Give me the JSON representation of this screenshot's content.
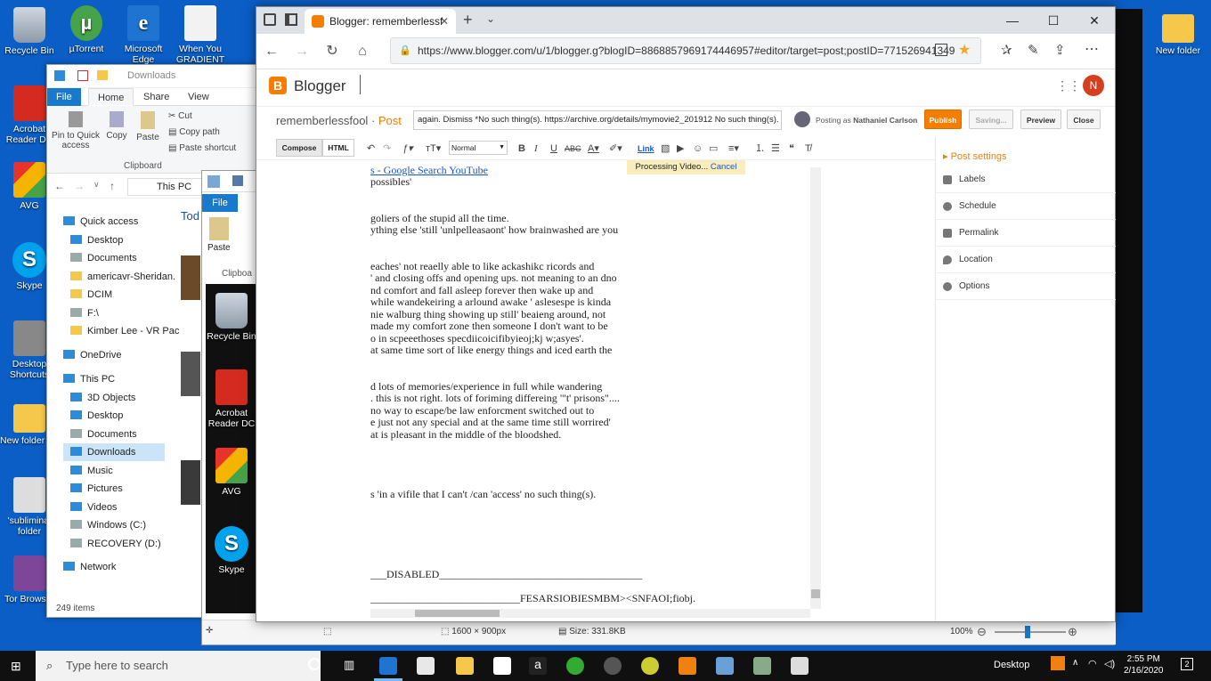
{
  "desktop": {
    "icons_left": [
      "Recycle Bin",
      "Acrobat Reader DC",
      "AVG",
      "Skype",
      "Desktop Shortcuts",
      "New folder (3)",
      "'subliminal folder",
      "Tor Browser"
    ],
    "icons_top": [
      "µTorrent",
      "Microsoft Edge",
      "When You GRADIENT"
    ],
    "icon_right": "New folder"
  },
  "explorer": {
    "title": "Downloads",
    "tabs": [
      "File",
      "Home",
      "Share",
      "View"
    ],
    "ribbon": {
      "pin": "Pin to Quick access",
      "copy": "Copy",
      "paste": "Paste",
      "cut": "Cut",
      "copy_path": "Copy path",
      "paste_shortcut": "Paste shortcut",
      "group": "Clipboard"
    },
    "path": "This PC",
    "tree": [
      "Quick access",
      "Desktop",
      "Documents",
      "americavr-Sheridan.",
      "DCIM",
      "F:\\",
      "Kimber Lee - VR Pac",
      "OneDrive",
      "This PC",
      "3D Objects",
      "Desktop",
      "Documents",
      "Downloads",
      "Music",
      "Pictures",
      "Videos",
      "Windows (C:)",
      "RECOVERY (D:)",
      "Network"
    ],
    "count": "249 items",
    "today": "Tod"
  },
  "viewer": {
    "tabs": [
      "File"
    ],
    "paste": "Paste",
    "clip": "Clipboa",
    "icons": [
      "Recycle Bin",
      "Acrobat Reader DC",
      "AVG",
      "Skype"
    ],
    "status": {
      "dims": "1600 × 900px",
      "size": "Size: 331.8KB",
      "zoom": "100%"
    }
  },
  "browser": {
    "tab_title": "Blogger: rememberlessf",
    "url": "https://www.blogger.com/u/1/blogger.g?blogID=8868857969174446957#editor/target=post;postID=771526941349",
    "app": "Blogger",
    "avatar": "N",
    "blog_name": "rememberlessfool",
    "post_label": "Post",
    "post_title": "again. Dismiss *No such thing(s). https://archive.org/details/mymovie2_201912  No such thing(s).",
    "posting_as": "Posting as",
    "user": "Nathaniel Carlson",
    "buttons": {
      "publish": "Publish",
      "saving": "Saving...",
      "preview": "Preview",
      "close": "Close"
    },
    "modes": {
      "compose": "Compose",
      "html": "HTML"
    },
    "format": "Normal",
    "link": "Link",
    "processing": "Processing Video...",
    "cancel": "Cancel",
    "editor_lines": [
      "s - Google Search YouTube",
      "possibles'",
      "",
      "goliers of the stupid all the time.",
      "ything else 'still 'unlpelleasaont' how brainwashed are you",
      "",
      "eaches' not reaelly able to like ackashikc ricords and",
      "' and closing offs and opening ups. not meaning to an dno",
      "nd comfort and fall asleep forever then wake up and",
      " while wandekeiring a arlound awake ' aslesespe is kinda",
      "nie walburg thing showing up still' beaieng around, not",
      " made my comfort zone then someone I don't want to be",
      "o in scpeeethoses specdiicoicifibyieoj;kj w;asyes'.",
      " at same time sort of like energy things and iced earth the",
      "",
      "d lots of memories/experience in full while wandering",
      ". this is not right. lots of foriming differeing \"'t' prisons\"....",
      "no way to escape/be law enforcment switched out to",
      "e just not any special and at the same time still worrired'",
      "at is pleasant in the middle of the bloodshed.",
      "",
      "",
      "",
      "",
      "s 'in a vifile that I can't /can 'access' no such thing(s).",
      "",
      "",
      "",
      "",
      "",
      "___DISABLED______________________________________",
      "",
      "____________________________FESARSIOBIESMBM><SNFAOI;fiobj."
    ],
    "sidebar": {
      "title": "Post settings",
      "items": [
        "Labels",
        "Schedule",
        "Permalink",
        "Location",
        "Options"
      ]
    }
  },
  "taskbar": {
    "search": "Type here to search",
    "desktop": "Desktop",
    "time": "2:55 PM",
    "date": "2/16/2020",
    "badge": "2"
  }
}
